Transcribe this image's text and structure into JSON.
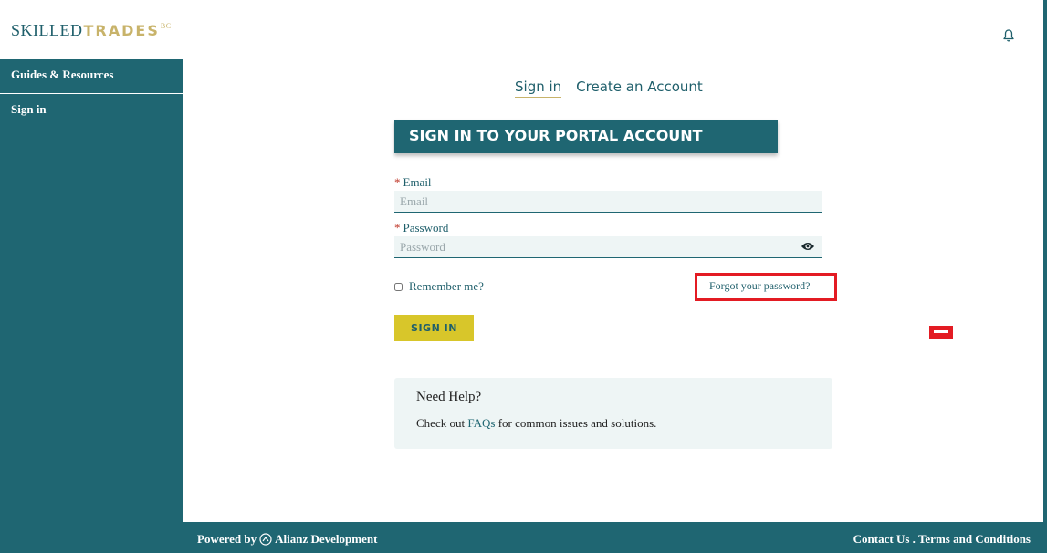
{
  "header": {
    "logo_skilled": "SKILLED",
    "logo_trades": "TRADES",
    "logo_bc": "BC",
    "bell_icon": "bell-icon"
  },
  "sidebar": {
    "items": [
      {
        "label": "Guides & Resources"
      },
      {
        "label": "Sign in"
      }
    ]
  },
  "tabs": [
    {
      "label": "Sign in",
      "active": true
    },
    {
      "label": "Create an Account",
      "active": false
    }
  ],
  "form": {
    "title": "SIGN IN TO YOUR PORTAL ACCOUNT",
    "required_mark": "*",
    "email_label": "Email",
    "email_placeholder": "Email",
    "password_label": "Password",
    "password_placeholder": "Password",
    "show_password_icon": "eye-icon",
    "remember_label": "Remember me?",
    "forgot_label": "Forgot your password?",
    "signin_button": "SIGN IN"
  },
  "help": {
    "title": "Need Help?",
    "text_before": "Check out ",
    "link": "FAQs",
    "text_after": " for common issues and solutions."
  },
  "footer": {
    "powered_by": "Powered by",
    "company": "Alianz Development",
    "contact": "Contact Us",
    "separator": " . ",
    "terms": "Terms and Conditions"
  },
  "colors": {
    "primary": "#1f6672",
    "accent_gold": "#c8b36a",
    "button_yellow": "#d8c62a",
    "highlight_red": "#e31b23"
  }
}
